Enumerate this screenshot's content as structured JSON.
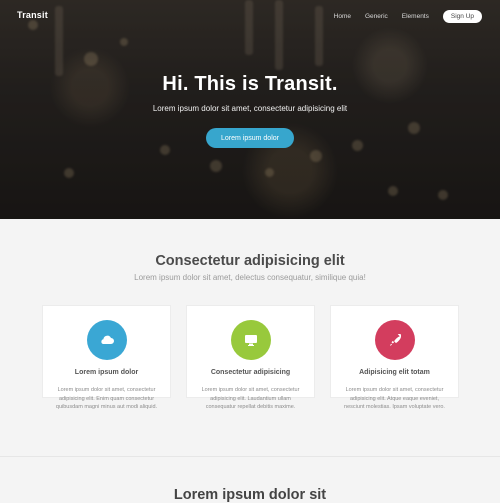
{
  "header": {
    "brand": "Transit",
    "nav": [
      "Home",
      "Generic",
      "Elements"
    ],
    "signup": "Sign Up"
  },
  "hero": {
    "title": "Hi. This is Transit.",
    "subtitle": "Lorem ipsum dolor sit amet, consectetur adipisicing elit",
    "button": "Lorem ipsum dolor"
  },
  "features": {
    "title": "Consectetur adipisicing elit",
    "subtitle": "Lorem ipsum dolor sit amet, delectus consequatur, similique quia!",
    "cards": [
      {
        "icon": "cloud-icon",
        "color": "#3aa7d4",
        "title": "Lorem ipsum dolor",
        "body": "Lorem ipsum dolor sit amet, consectetur adipisicing elit. Enim quam consectetur quibusdam magni minus aut modi aliquid."
      },
      {
        "icon": "desktop-icon",
        "color": "#98c93c",
        "title": "Consectetur adipisicing",
        "body": "Lorem ipsum dolor sit amet, consectetur adipisicing elit. Laudantium ullam consequatur repellat debitis maxime."
      },
      {
        "icon": "rocket-icon",
        "color": "#d33d5e",
        "title": "Adipisicing elit totam",
        "body": "Lorem ipsum dolor sit amet, consectetur adipisicing elit. Atque eaque eveniet, nesciunt molestias. Ipsam voluptate vero."
      }
    ]
  },
  "section2": {
    "title": "Lorem ipsum dolor sit"
  }
}
